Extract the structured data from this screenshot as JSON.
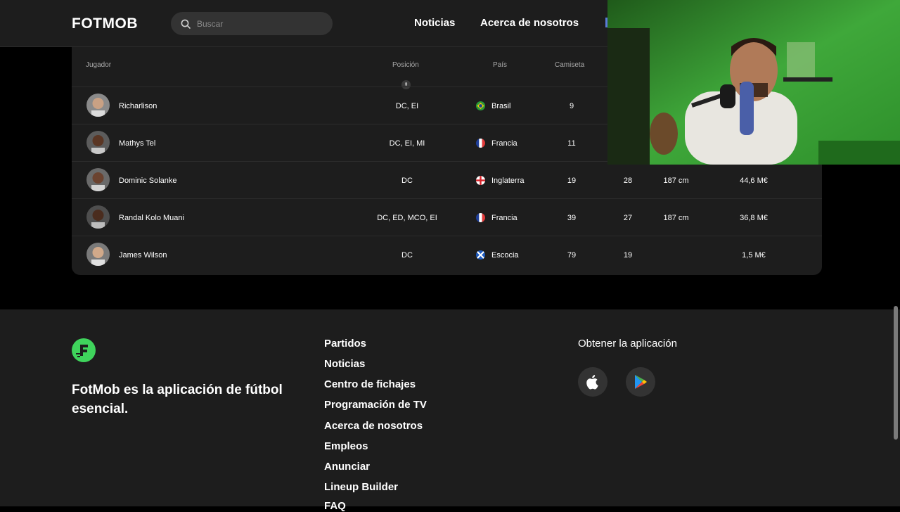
{
  "header": {
    "logo": "FOTMOB",
    "search_placeholder": "Buscar",
    "nav": [
      "Noticias",
      "Acerca de nosotros"
    ]
  },
  "table": {
    "columns": [
      "Jugador",
      "Posición",
      "País",
      "Camiseta"
    ],
    "rows": [
      {
        "name": "Richarlison",
        "position": "DC, EI",
        "country": "Brasil",
        "shirt": "9",
        "age": "",
        "height": "",
        "value": ""
      },
      {
        "name": "Mathys Tel",
        "position": "DC, EI, MI",
        "country": "Francia",
        "shirt": "11",
        "age": "",
        "height": "",
        "value": ""
      },
      {
        "name": "Dominic Solanke",
        "position": "DC",
        "country": "Inglaterra",
        "shirt": "19",
        "age": "28",
        "height": "187 cm",
        "value": "44,6 M€"
      },
      {
        "name": "Randal Kolo Muani",
        "position": "DC, ED, MCO, EI",
        "country": "Francia",
        "shirt": "39",
        "age": "27",
        "height": "187 cm",
        "value": "36,8 M€"
      },
      {
        "name": "James Wilson",
        "position": "DC",
        "country": "Escocia",
        "shirt": "79",
        "age": "19",
        "height": "",
        "value": "1,5 M€"
      }
    ]
  },
  "footer": {
    "tagline": "FotMob es la aplicación de fútbol esencial.",
    "links": [
      "Partidos",
      "Noticias",
      "Centro de fichajes",
      "Programación de TV",
      "Acerca de nosotros",
      "Empleos",
      "Anunciar",
      "Lineup Builder",
      "FAQ"
    ],
    "app_title": "Obtener la aplicación",
    "stores": [
      "apple-icon",
      "google-play-icon"
    ]
  },
  "colors": {
    "background": "#000000",
    "panel": "#1d1d1d",
    "accent": "#3fd45c"
  }
}
